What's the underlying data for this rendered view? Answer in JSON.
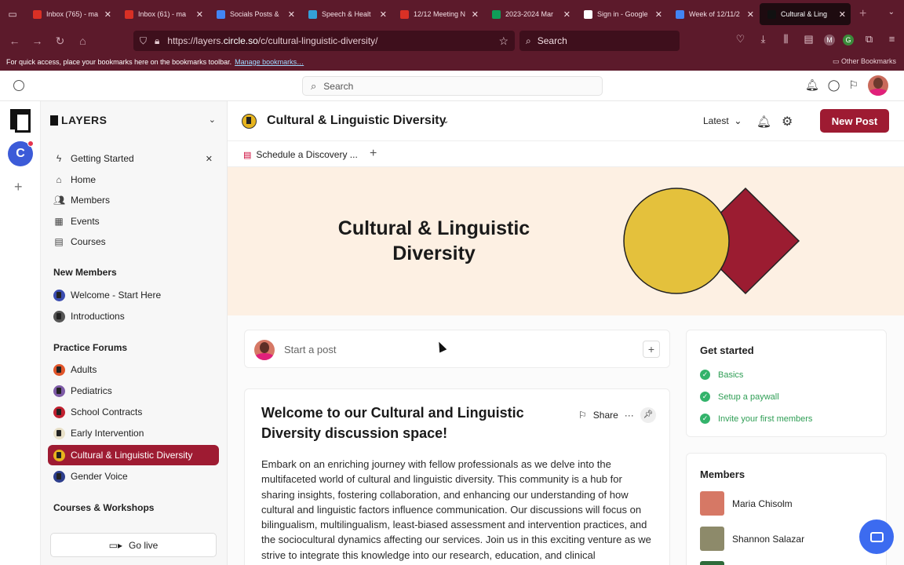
{
  "browser": {
    "tabs": [
      {
        "title": "Inbox (765) - ma",
        "icon": "gmail-icon",
        "color": "#d93025"
      },
      {
        "title": "Inbox (61) - ma",
        "icon": "gmail-icon",
        "color": "#d93025"
      },
      {
        "title": "Socials Posts &",
        "icon": "docs-icon",
        "color": "#4285f4"
      },
      {
        "title": "Speech & Healt",
        "icon": "slides-icon",
        "color": "#34a0d8"
      },
      {
        "title": "12/12 Meeting N",
        "icon": "gmail-icon",
        "color": "#d93025"
      },
      {
        "title": "2023-2024 Mar",
        "icon": "sheets-icon",
        "color": "#0f9d58"
      },
      {
        "title": "Sign in - Google",
        "icon": "google-icon",
        "color": "#ffffff"
      },
      {
        "title": "Week of 12/11/2",
        "icon": "docs-icon",
        "color": "#4285f4"
      },
      {
        "title": "Cultural & Ling",
        "icon": "circle-icon",
        "color": "#111111"
      }
    ],
    "url_prefix": "https://layers.",
    "url_domain": "circle.so",
    "url_path": "/c/cultural-linguistic-diversity/",
    "search_placeholder": "Search",
    "bookmarks_text": "For quick access, place your bookmarks here on the bookmarks toolbar.",
    "manage_bookmarks": "Manage bookmarks…",
    "other_bookmarks": "Other Bookmarks"
  },
  "app": {
    "search_placeholder": "Search",
    "workspace_initial": "C",
    "brand": "LAYERS"
  },
  "sidebar": {
    "top_items": [
      {
        "label": "Getting Started",
        "icon": "bolt-icon"
      },
      {
        "label": "Home",
        "icon": "home-icon"
      },
      {
        "label": "Members",
        "icon": "members-icon"
      },
      {
        "label": "Events",
        "icon": "calendar-icon"
      },
      {
        "label": "Courses",
        "icon": "book-icon"
      }
    ],
    "sections": [
      {
        "title": "New Members",
        "items": [
          {
            "label": "Welcome - Start Here",
            "color": "#3b4db0"
          },
          {
            "label": "Introductions",
            "color": "#444444"
          }
        ]
      },
      {
        "title": "Practice Forums",
        "items": [
          {
            "label": "Adults",
            "color": "#e0552a"
          },
          {
            "label": "Pediatrics",
            "color": "#7d5aa6"
          },
          {
            "label": "School Contracts",
            "color": "#c0202f"
          },
          {
            "label": "Early Intervention",
            "color": "#e8e0c8"
          },
          {
            "label": "Cultural & Linguistic Diversity",
            "color": "#e6b41e"
          },
          {
            "label": "Gender Voice",
            "color": "#2d3e8c"
          }
        ]
      },
      {
        "title": "Courses & Workshops",
        "items": []
      }
    ],
    "go_live": "Go live"
  },
  "space": {
    "title": "Cultural & Linguistic Diversity",
    "sort": "Latest",
    "new_post": "New Post",
    "link": "Schedule a Discovery ...",
    "banner_line1": "Cultural & Linguistic",
    "banner_line2": "Diversity",
    "composer_placeholder": "Start a post"
  },
  "post": {
    "title": "Welcome to our Cultural and Linguistic Diversity discussion space!",
    "share": "Share",
    "body": "Embark on an enriching journey with fellow professionals as we delve into the multifaceted world of cultural and linguistic diversity. This community is a hub for sharing insights, fostering collaboration, and enhancing our understanding of how cultural and linguistic factors influence communication. Our discussions will focus on bilingualism, multilingualism, least-biased assessment and intervention practices, and the sociocultural dynamics affecting our services. Join us in this exciting venture as we strive to integrate this knowledge into our research, education, and clinical"
  },
  "get_started": {
    "title": "Get started",
    "items": [
      "Basics",
      "Setup a paywall",
      "Invite your first members"
    ]
  },
  "members": {
    "title": "Members",
    "list": [
      {
        "name": "Maria Chisolm"
      },
      {
        "name": "Shannon Salazar"
      }
    ]
  },
  "colors": {
    "brand": "#9e1b32",
    "chrome": "#5c1a2b",
    "banner": "#fdf0e3"
  }
}
